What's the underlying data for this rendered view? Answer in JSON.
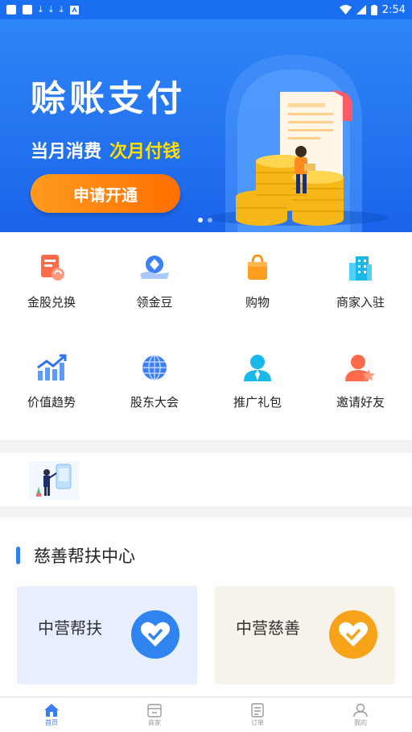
{
  "status_bar": {
    "time": "2:54"
  },
  "banner": {
    "title": "赊账支付",
    "subtitle_left": "当月消费",
    "subtitle_right": "次月付钱",
    "button_label": "申请开通",
    "dots": 2,
    "active_dot": 0
  },
  "grid": {
    "items": [
      {
        "label": "金股兑换",
        "icon": "document-exchange-icon"
      },
      {
        "label": "领金豆",
        "icon": "coin-hand-icon"
      },
      {
        "label": "购物",
        "icon": "shopping-bag-icon"
      },
      {
        "label": "商家入驻",
        "icon": "building-icon"
      },
      {
        "label": "价值趋势",
        "icon": "trend-chart-icon"
      },
      {
        "label": "股东大会",
        "icon": "globe-icon"
      },
      {
        "label": "推广礼包",
        "icon": "person-tie-icon"
      },
      {
        "label": "邀请好友",
        "icon": "person-star-icon"
      }
    ]
  },
  "charity": {
    "title": "慈善帮扶中心",
    "cards": [
      {
        "label": "中营帮扶",
        "icon": "heart-handshake-icon",
        "color": "#2f84f0"
      },
      {
        "label": "中营慈善",
        "icon": "heart-handshake-icon",
        "color": "#f6a31a"
      }
    ]
  },
  "tabbar": {
    "tabs": [
      {
        "label": "首页",
        "icon": "home-icon",
        "active": true
      },
      {
        "label": "商家",
        "icon": "store-icon",
        "active": false
      },
      {
        "label": "订单",
        "icon": "order-icon",
        "active": false
      },
      {
        "label": "我的",
        "icon": "profile-icon",
        "active": false
      }
    ]
  },
  "colors": {
    "brand_blue": "#1a6ff0",
    "accent_orange": "#ff8a00",
    "accent_yellow": "#ffe100"
  }
}
